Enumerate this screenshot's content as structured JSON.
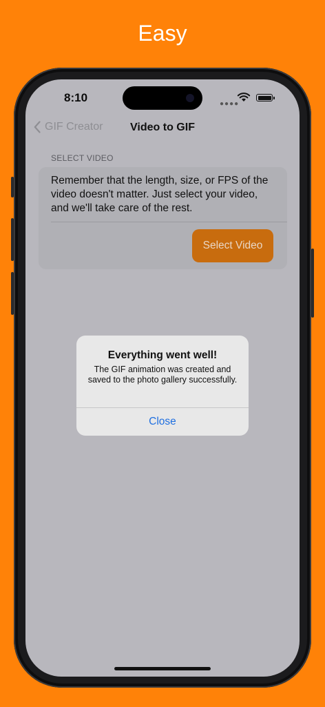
{
  "headline": "Easy",
  "status_bar": {
    "time": "8:10"
  },
  "nav": {
    "back_label": "GIF Creator",
    "title": "Video to GIF"
  },
  "section": {
    "header": "SELECT VIDEO",
    "description": "Remember that the length, size, or FPS of the video doesn't matter. Just select your video, and we'll take care of the rest.",
    "button_label": "Select Video"
  },
  "alert": {
    "title": "Everything went well!",
    "message": "The GIF animation was created and saved to the photo gallery successfully.",
    "button_label": "Close"
  },
  "colors": {
    "background": "#FF8208",
    "accent": "#C86C0E",
    "link": "#1F6FE0"
  }
}
